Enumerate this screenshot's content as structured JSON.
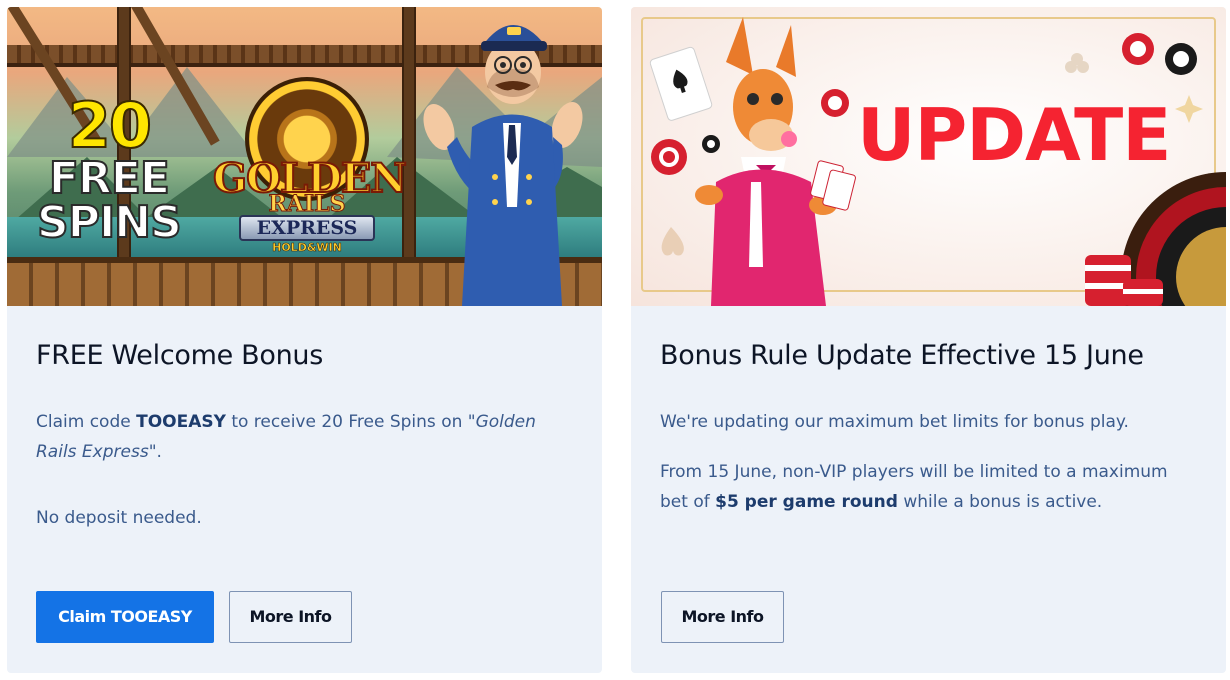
{
  "cards": [
    {
      "banner": {
        "spins_number": "20",
        "spins_word_1": "FREE",
        "spins_word_2": "SPINS",
        "game_logo_line1": "GOLDEN",
        "game_logo_line2": "RAILS",
        "game_logo_line3": "EXPRESS",
        "game_logo_line4": "HOLD&WIN"
      },
      "title": "FREE Welcome Bonus",
      "text1_before": "Claim code ",
      "text1_code": "TOOEASY",
      "text1_mid": " to receive 20 Free Spins on \"",
      "text1_game": "Golden Rails Express",
      "text1_after": "\".",
      "text2": "No deposit needed.",
      "primary_button": "Claim TOOEASY",
      "secondary_button": "More Info"
    },
    {
      "banner": {
        "headline": "UPDATE"
      },
      "title": "Bonus Rule Update Effective 15 June",
      "text1": "We're updating our maximum bet limits for bonus play.",
      "text2_before": "From 15 June, non-VIP players will be limited to a maximum bet of ",
      "text2_bold": "$5 per game round",
      "text2_after": " while a bonus is active.",
      "secondary_button": "More Info"
    }
  ],
  "colors": {
    "card_bg": "#edf2f9",
    "primary": "#1473e6",
    "text_body": "#3a5a8c",
    "title": "#0d1526",
    "update_red": "#f52331"
  }
}
